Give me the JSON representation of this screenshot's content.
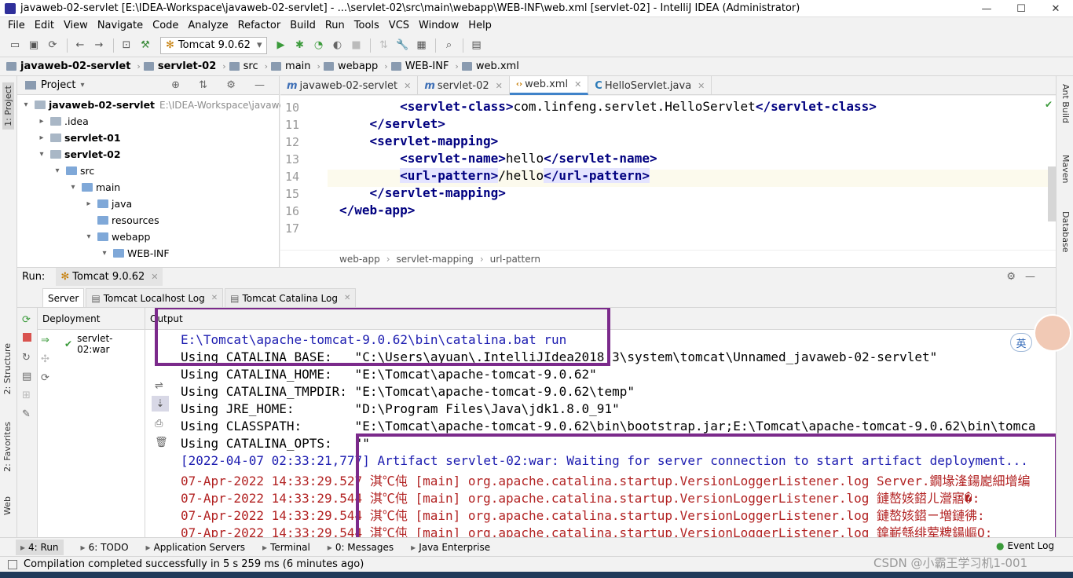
{
  "window": {
    "title": "javaweb-02-servlet [E:\\IDEA-Workspace\\javaweb-02-servlet] - ...\\servlet-02\\src\\main\\webapp\\WEB-INF\\web.xml [servlet-02] - IntelliJ IDEA (Administrator)",
    "minimize": "—",
    "maximize": "☐",
    "close": "✕"
  },
  "menu": [
    "File",
    "Edit",
    "View",
    "Navigate",
    "Code",
    "Analyze",
    "Refactor",
    "Build",
    "Run",
    "Tools",
    "VCS",
    "Window",
    "Help"
  ],
  "toolbar": {
    "run_config": "Tomcat 9.0.62"
  },
  "breadcrumbs": [
    "javaweb-02-servlet",
    "servlet-02",
    "src",
    "main",
    "webapp",
    "WEB-INF",
    "web.xml"
  ],
  "left_tool_tabs": [
    "1: Project",
    "2: Structure",
    "2: Favorites",
    "Web"
  ],
  "right_tool_tabs": [
    "Ant Build",
    "Maven",
    "Database"
  ],
  "project": {
    "header": "Project",
    "tree": [
      {
        "label": "javaweb-02-servlet",
        "extra": "E:\\IDEA-Workspace\\javaweb-0",
        "indent": 0,
        "arrow": "▾",
        "bold": true
      },
      {
        "label": ".idea",
        "indent": 1,
        "arrow": "▸"
      },
      {
        "label": "servlet-01",
        "indent": 1,
        "arrow": "▸",
        "bold": true
      },
      {
        "label": "servlet-02",
        "indent": 1,
        "arrow": "▾",
        "bold": true
      },
      {
        "label": "src",
        "indent": 2,
        "arrow": "▾"
      },
      {
        "label": "main",
        "indent": 3,
        "arrow": "▾"
      },
      {
        "label": "java",
        "indent": 4,
        "arrow": "▸"
      },
      {
        "label": "resources",
        "indent": 4,
        "arrow": ""
      },
      {
        "label": "webapp",
        "indent": 4,
        "arrow": "▾"
      },
      {
        "label": "WEB-INF",
        "indent": 5,
        "arrow": "▾"
      }
    ]
  },
  "editor": {
    "tabs": [
      {
        "label": "javaweb-02-servlet",
        "icon": "m"
      },
      {
        "label": "servlet-02",
        "icon": "m"
      },
      {
        "label": "web.xml",
        "icon": "xml",
        "active": true
      },
      {
        "label": "HelloServlet.java",
        "icon": "C"
      }
    ],
    "lines": [
      {
        "n": "10",
        "indent": "        ",
        "parts": [
          [
            "t",
            "<servlet-class>"
          ],
          [
            "x",
            "com.linfeng.servlet.HelloServlet"
          ],
          [
            "t",
            "</servlet-class>"
          ]
        ]
      },
      {
        "n": "11",
        "indent": "    ",
        "parts": [
          [
            "t",
            "</servlet>"
          ]
        ]
      },
      {
        "n": "12",
        "indent": "    ",
        "parts": [
          [
            "t",
            "<servlet-mapping>"
          ]
        ]
      },
      {
        "n": "13",
        "indent": "        ",
        "parts": [
          [
            "t",
            "<servlet-name>"
          ],
          [
            "x",
            "hello"
          ],
          [
            "t",
            "</servlet-name>"
          ]
        ]
      },
      {
        "n": "14",
        "indent": "        ",
        "parts": [
          [
            "h",
            "<url-pattern>"
          ],
          [
            "x",
            "/hello"
          ],
          [
            "h",
            "</url-pattern>"
          ]
        ]
      },
      {
        "n": "15",
        "indent": "    ",
        "parts": [
          [
            "t",
            "</servlet-mapping>"
          ]
        ]
      },
      {
        "n": "16",
        "indent": "",
        "parts": [
          [
            "t",
            "</web-app>"
          ]
        ]
      },
      {
        "n": "17",
        "indent": "",
        "parts": []
      }
    ],
    "current_line": "14",
    "crumbs": [
      "web-app",
      "servlet-mapping",
      "url-pattern"
    ]
  },
  "run": {
    "label": "Run:",
    "config": "Tomcat 9.0.62",
    "tabs": [
      "Server",
      "Tomcat Localhost Log",
      "Tomcat Catalina Log"
    ],
    "deployment_header": "Deployment",
    "deployment_item": "servlet-02:war",
    "output_header": "Output",
    "output": [
      {
        "text": "E:\\Tomcat\\apache-tomcat-9.0.62\\bin\\catalina.bat run",
        "style": "blue"
      },
      {
        "text": "Using CATALINA_BASE:   \"C:\\Users\\ayuan\\.IntelliJIdea2018.3\\system\\tomcat\\Unnamed_javaweb-02-servlet\"",
        "style": ""
      },
      {
        "text": "Using CATALINA_HOME:   \"E:\\Tomcat\\apache-tomcat-9.0.62\"",
        "style": ""
      },
      {
        "text": "Using CATALINA_TMPDIR: \"E:\\Tomcat\\apache-tomcat-9.0.62\\temp\"",
        "style": ""
      },
      {
        "text": "Using JRE_HOME:        \"D:\\Program Files\\Java\\jdk1.8.0_91\"",
        "style": ""
      },
      {
        "text": "Using CLASSPATH:       \"E:\\Tomcat\\apache-tomcat-9.0.62\\bin\\bootstrap.jar;E:\\Tomcat\\apache-tomcat-9.0.62\\bin\\tomca",
        "style": ""
      },
      {
        "text": "Using CATALINA_OPTS:   \"\"",
        "style": ""
      },
      {
        "text": "[2022-04-07 02:33:21,777] Artifact servlet-02:war: Waiting for server connection to start artifact deployment...",
        "style": "blue"
      },
      {
        "text": "07-Apr-2022 14:33:29.527 淇℃伅 [main] org.apache.catalina.startup.VersionLoggerListener.log Server.鐗堟湰鍚嶏細增编",
        "style": "red"
      },
      {
        "text": "07-Apr-2022 14:33:29.544 淇℃伅 [main] org.apache.catalina.startup.VersionLoggerListener.log 鏈嶅姟鍣ㄦ瀯寤�:",
        "style": "red"
      },
      {
        "text": "07-Apr-2022 14:33:29.544 淇℃伅 [main] org.apache.catalina.startup.VersionLoggerListener.log 鏈嶅姟鍣ㄧ増鏈彿:",
        "style": "red"
      },
      {
        "text": "07-Apr-2022 14:33:29.544 淇℃伅 [main] org.apache.catalina.startup.VersionLoggerListener.log 鎿嶄綔绯荤粺鍚嶇О:",
        "style": "red"
      }
    ]
  },
  "bottom_tabs": [
    "4: Run",
    "6: TODO",
    "Application Servers",
    "Terminal",
    "0: Messages",
    "Java Enterprise"
  ],
  "event_log": "Event Log",
  "status": "Compilation completed successfully in 5 s 259 ms (6 minutes ago)",
  "status_right": "CSDN @小霸王学习机1-001",
  "ime": "英",
  "colors": {
    "annotation": "#7b2a8b",
    "tag": "#000080"
  }
}
